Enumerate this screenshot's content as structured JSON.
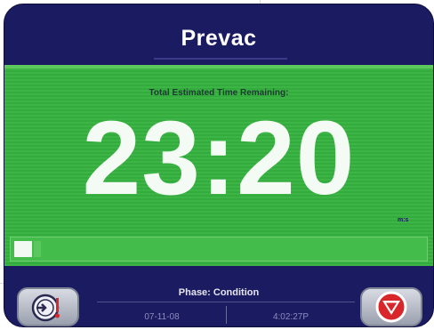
{
  "header": {
    "title": "Prevac"
  },
  "timer": {
    "label": "Total Estimated Time Remaining:",
    "value": "23:20",
    "unit": "m:s"
  },
  "progress": {
    "fraction": 0.06
  },
  "footer": {
    "phase": "Phase: Condition",
    "date": "07-11-08",
    "time": "4:02:27P"
  },
  "icons": {
    "left_button": "gauge-exit-icon",
    "right_button": "stop-triangle-icon"
  },
  "colors": {
    "frame": "#1b1b62",
    "panel": "#35b23f",
    "stop_red": "#d8262a"
  }
}
